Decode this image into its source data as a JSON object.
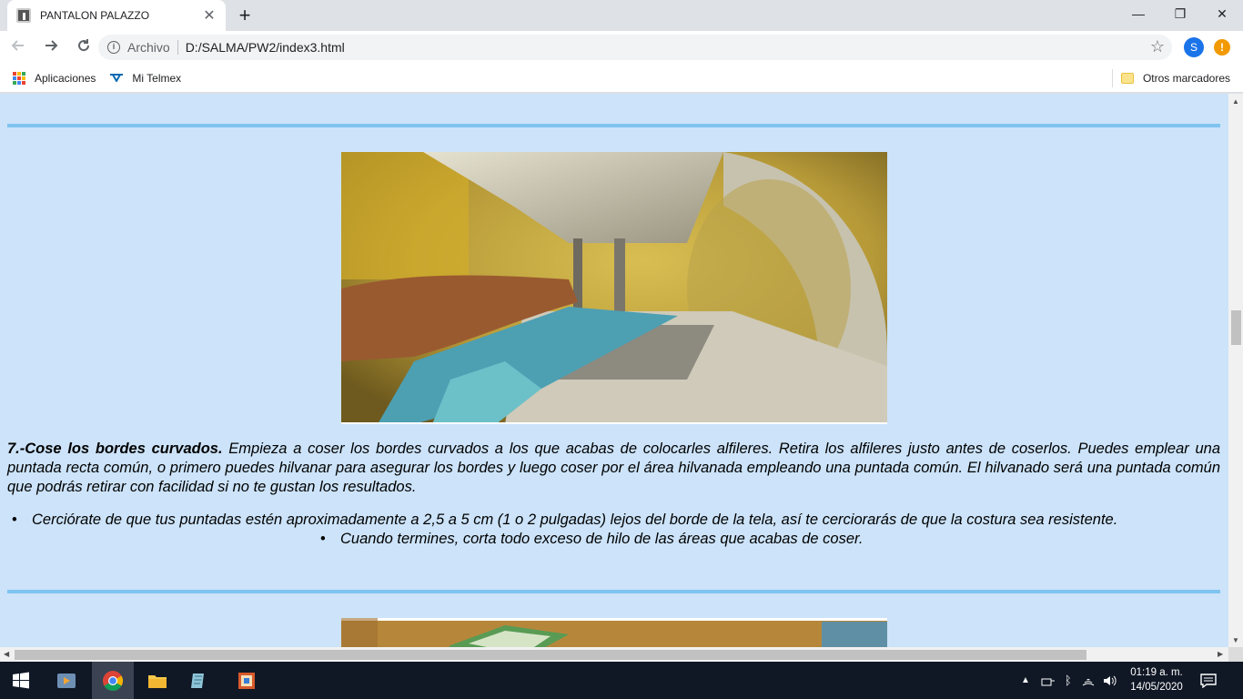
{
  "browser": {
    "tab_title": "PANTALON PALAZZO",
    "close_glyph": "✕",
    "new_tab_glyph": "+",
    "url_scheme": "Archivo",
    "url": "D:/SALMA/PW2/index3.html",
    "profile_initial": "S",
    "alert_glyph": "!",
    "window_controls": {
      "minimize": "—",
      "restore": "❐",
      "close": "✕"
    }
  },
  "bookmarks": {
    "apps_label": "Aplicaciones",
    "telmex_label": "Mi Telmex",
    "other_label": "Otros marcadores"
  },
  "page": {
    "step_heading": "7.-Cose los bordes curvados.",
    "step_text": " Empieza a coser los bordes curvados a los que acabas de colocarles alfileres. Retira los alfileres justo antes de coserlos. Puedes emplear una puntada recta común, o primero puedes hilvanar para asegurar los bordes y luego coser por el área hilvanada empleando una puntada común. El hilvanado será una puntada común que podrás retirar con facilidad si no te gustan los resultados.",
    "bullets": [
      "Cerciórate de que tus puntadas estén aproximadamente a 2,5 a 5 cm (1 o 2 pulgadas) lejos del borde de la tela, así te cerciorarás de que la costura sea resistente.",
      "Cuando termines, corta todo exceso de hilo de las áreas que acabas de coser."
    ]
  },
  "taskbar": {
    "time": "01:19 a. m.",
    "date": "14/05/2020"
  },
  "colors": {
    "page_bg": "#cce3f9",
    "divider": "#7fc4f1",
    "taskbar_bg": "#101826"
  }
}
